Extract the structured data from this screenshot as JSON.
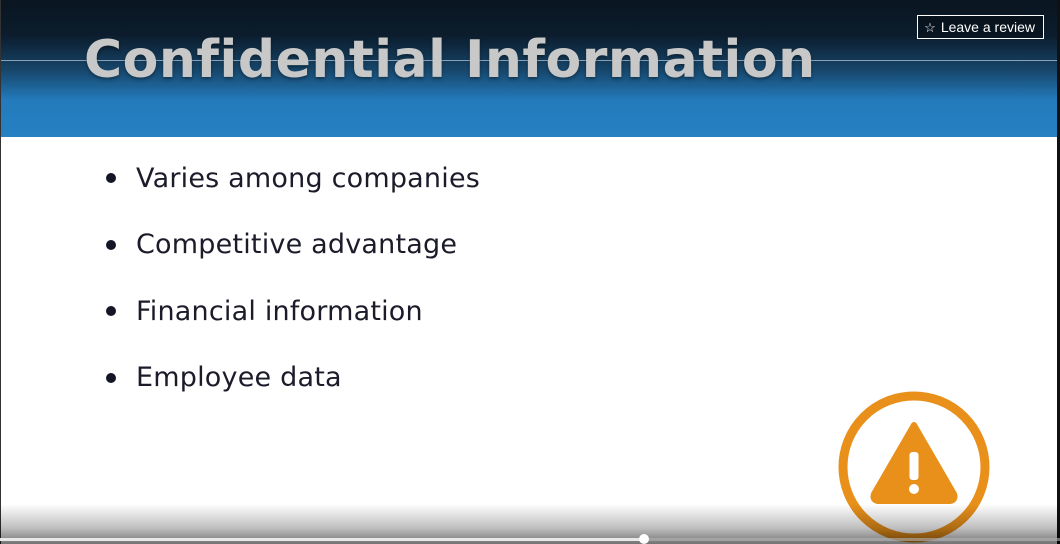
{
  "slide": {
    "title": "Confidential Information",
    "bullets": [
      "Varies among companies",
      "Competitive advantage",
      "Financial information",
      "Employee data"
    ]
  },
  "review_button": {
    "icon": "star-outline-icon",
    "label": "Leave a review"
  },
  "warning": {
    "icon": "warning-triangle-icon",
    "color": "#e8901a"
  },
  "player": {
    "progress_fraction": 0.608
  },
  "colors": {
    "header_blue": "#2680c2",
    "text_dark": "#1b1b2a",
    "accent_orange": "#e8901a"
  }
}
